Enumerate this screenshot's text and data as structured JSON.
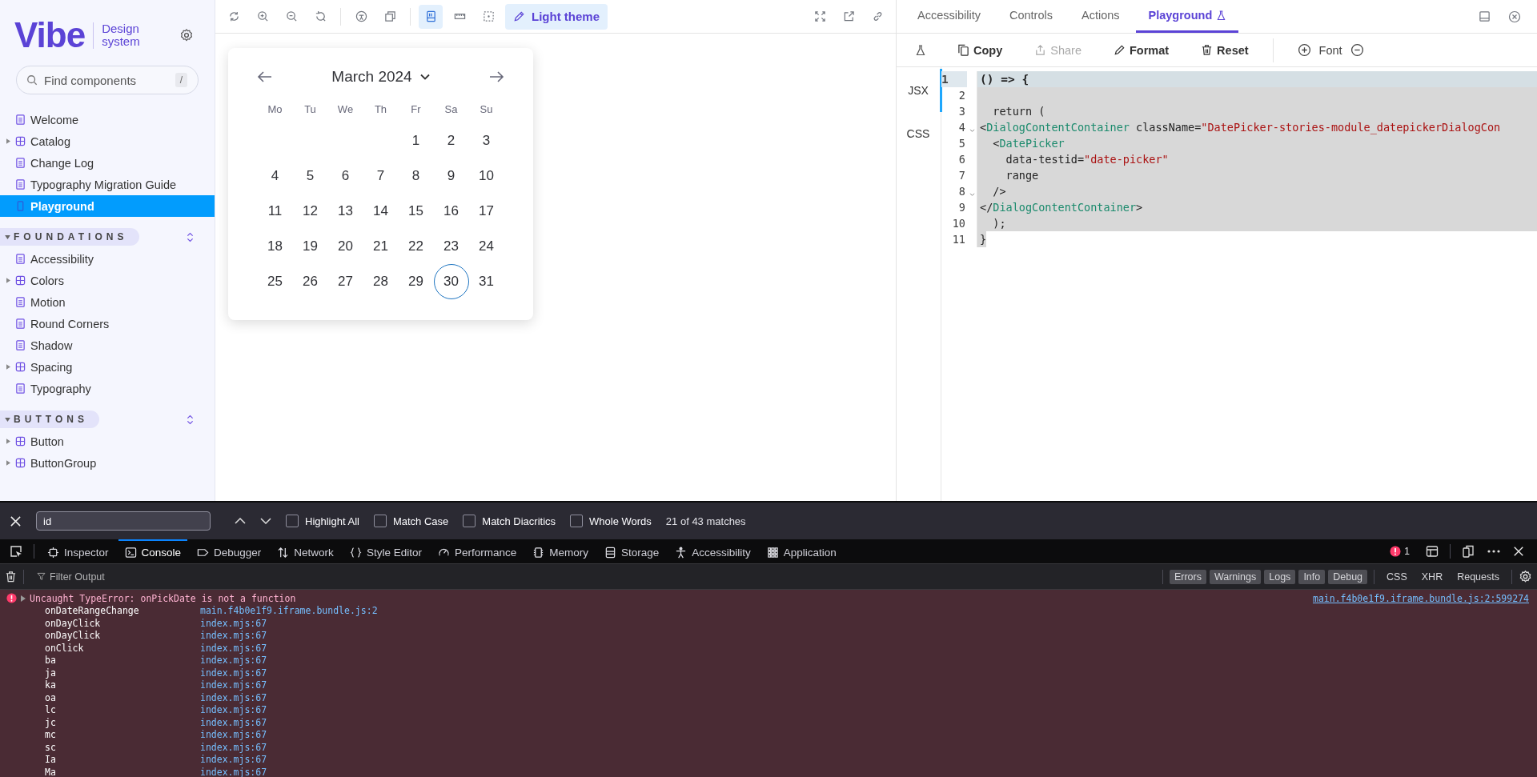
{
  "sidebar": {
    "logo": "Vibe",
    "logo_sub": "Design system",
    "search": {
      "placeholder": "Find components",
      "shortcut": "/"
    },
    "items": [
      {
        "label": "Welcome",
        "kind": "doc",
        "selected": false
      },
      {
        "label": "Catalog",
        "kind": "folder",
        "selected": false
      },
      {
        "label": "Change Log",
        "kind": "doc",
        "selected": false
      },
      {
        "label": "Typography Migration Guide",
        "kind": "doc",
        "selected": false
      },
      {
        "label": "Playground",
        "kind": "story",
        "selected": true
      }
    ],
    "sections": [
      {
        "title": "FOUNDATIONS",
        "expanded": true,
        "items": [
          {
            "label": "Accessibility",
            "kind": "doc",
            "selected": false
          },
          {
            "label": "Colors",
            "kind": "folder",
            "selected": false
          },
          {
            "label": "Motion",
            "kind": "doc",
            "selected": false
          },
          {
            "label": "Round Corners",
            "kind": "doc",
            "selected": false
          },
          {
            "label": "Shadow",
            "kind": "doc",
            "selected": false
          },
          {
            "label": "Spacing",
            "kind": "folder",
            "selected": false
          },
          {
            "label": "Typography",
            "kind": "doc",
            "selected": false
          }
        ]
      },
      {
        "title": "BUTTONS",
        "expanded": true,
        "items": [
          {
            "label": "Button",
            "kind": "folder",
            "selected": false
          },
          {
            "label": "ButtonGroup",
            "kind": "folder",
            "selected": false
          }
        ]
      }
    ]
  },
  "toolbar": {
    "groups": [
      {
        "tools": [
          {
            "kind": "refresh",
            "selected": false
          },
          {
            "kind": "zoom-in",
            "selected": false
          },
          {
            "kind": "zoom-out",
            "selected": false
          },
          {
            "kind": "reset",
            "selected": false
          }
        ]
      },
      {
        "tools": [
          {
            "kind": "accessibility",
            "selected": false
          },
          {
            "kind": "layers",
            "selected": false
          }
        ]
      },
      {
        "tools": [
          {
            "kind": "viewport",
            "selected": true
          },
          {
            "kind": "ruler",
            "selected": false
          },
          {
            "kind": "outline",
            "selected": false
          }
        ]
      }
    ],
    "theme": {
      "label": "Light theme",
      "selected": true
    },
    "right_tools": [
      {
        "kind": "fullscreen",
        "selected": false
      },
      {
        "kind": "external",
        "selected": false
      },
      {
        "kind": "link",
        "selected": false
      }
    ]
  },
  "calendar": {
    "title": "March 2024",
    "weekdays": [
      "Mo",
      "Tu",
      "We",
      "Th",
      "Fr",
      "Sa",
      "Su"
    ],
    "weeks": [
      {
        "days": [
          {
            "label": "1",
            "selected": false
          },
          {
            "label": "2",
            "selected": false
          },
          {
            "label": "3",
            "selected": false
          }
        ]
      },
      {
        "days": [
          {
            "label": "4",
            "selected": false
          },
          {
            "label": "5",
            "selected": false
          },
          {
            "label": "6",
            "selected": false
          },
          {
            "label": "7",
            "selected": false
          },
          {
            "label": "8",
            "selected": false
          },
          {
            "label": "9",
            "selected": false
          },
          {
            "label": "10",
            "selected": false
          }
        ]
      },
      {
        "days": [
          {
            "label": "11",
            "selected": false
          },
          {
            "label": "12",
            "selected": false
          },
          {
            "label": "13",
            "selected": false
          },
          {
            "label": "14",
            "selected": false
          },
          {
            "label": "15",
            "selected": false
          },
          {
            "label": "16",
            "selected": false
          },
          {
            "label": "17",
            "selected": false
          }
        ]
      },
      {
        "days": [
          {
            "label": "18",
            "selected": false
          },
          {
            "label": "19",
            "selected": false
          },
          {
            "label": "20",
            "selected": false
          },
          {
            "label": "21",
            "selected": false
          },
          {
            "label": "22",
            "selected": false
          },
          {
            "label": "23",
            "selected": false
          },
          {
            "label": "24",
            "selected": false
          }
        ]
      },
      {
        "days": [
          {
            "label": "25",
            "selected": false
          },
          {
            "label": "26",
            "selected": false
          },
          {
            "label": "27",
            "selected": false
          },
          {
            "label": "28",
            "selected": false
          },
          {
            "label": "29",
            "selected": false
          },
          {
            "label": "30",
            "selected": true
          },
          {
            "label": "31",
            "selected": false
          }
        ]
      }
    ]
  },
  "addon_panel": {
    "tabs": [
      {
        "label": "Accessibility",
        "selected": false
      },
      {
        "label": "Controls",
        "selected": false
      },
      {
        "label": "Actions",
        "selected": false
      },
      {
        "label": "Playground",
        "selected": true
      }
    ],
    "actions": [
      {
        "kind": "copy",
        "label": "Copy",
        "disabled": false
      },
      {
        "kind": "share",
        "label": "Share",
        "disabled": true
      },
      {
        "kind": "format",
        "label": "Format",
        "disabled": false
      },
      {
        "kind": "reset",
        "label": "Reset",
        "disabled": false
      }
    ],
    "font_label": "Font",
    "side_tabs": [
      {
        "label": "JSX",
        "selected": true
      },
      {
        "label": "CSS",
        "selected": false
      }
    ],
    "code_lines": [
      {
        "number": "1",
        "active": true,
        "foldable": false,
        "tokens": [
          {
            "kind": "plain",
            "text": "() => {"
          }
        ]
      },
      {
        "number": "2",
        "active": false,
        "foldable": false
      },
      {
        "number": "3",
        "active": false,
        "foldable": false,
        "tokens": [
          {
            "kind": "plain",
            "text": "  return ("
          }
        ]
      },
      {
        "number": "4",
        "active": false,
        "foldable": true,
        "tokens": [
          {
            "kind": "plain",
            "text": "<"
          },
          {
            "kind": "tag",
            "text": "DialogContentContainer"
          },
          {
            "kind": "plain",
            "text": " className="
          },
          {
            "kind": "string",
            "text": "\"DatePicker-stories-module_datepickerDialogCon"
          }
        ]
      },
      {
        "number": "5",
        "active": false,
        "foldable": false,
        "tokens": [
          {
            "kind": "plain",
            "text": "  <"
          },
          {
            "kind": "tag",
            "text": "DatePicker"
          }
        ]
      },
      {
        "number": "6",
        "active": false,
        "foldable": false,
        "tokens": [
          {
            "kind": "plain",
            "text": "    data-testid="
          },
          {
            "kind": "string",
            "text": "\"date-picker\""
          }
        ]
      },
      {
        "number": "7",
        "active": false,
        "foldable": false,
        "tokens": [
          {
            "kind": "plain",
            "text": "    range"
          }
        ]
      },
      {
        "number": "8",
        "active": false,
        "foldable": true,
        "tokens": [
          {
            "kind": "plain",
            "text": "  />"
          }
        ]
      },
      {
        "number": "9",
        "active": false,
        "foldable": false,
        "tokens": [
          {
            "kind": "plain",
            "text": "</"
          },
          {
            "kind": "tag",
            "text": "DialogContentContainer"
          },
          {
            "kind": "plain",
            "text": ">"
          }
        ]
      },
      {
        "number": "10",
        "active": false,
        "foldable": false,
        "tokens": [
          {
            "kind": "plain",
            "text": "  );"
          }
        ]
      },
      {
        "number": "11",
        "active": false,
        "foldable": false,
        "tokens": [
          {
            "kind": "plain",
            "text": "}"
          }
        ]
      }
    ]
  },
  "find_bar": {
    "value": "id",
    "options": [
      {
        "label": "Highlight All",
        "checked": false
      },
      {
        "label": "Match Case",
        "checked": false
      },
      {
        "label": "Match Diacritics",
        "checked": false
      },
      {
        "label": "Whole Words",
        "checked": false
      }
    ],
    "result": "21 of 43 matches"
  },
  "devtools": {
    "tabs": [
      {
        "kind": "inspector",
        "label": "Inspector",
        "selected": false
      },
      {
        "kind": "console",
        "label": "Console",
        "selected": true
      },
      {
        "kind": "debugger",
        "label": "Debugger",
        "selected": false
      },
      {
        "kind": "network",
        "label": "Network",
        "selected": false
      },
      {
        "kind": "style",
        "label": "Style Editor",
        "selected": false
      },
      {
        "kind": "performance",
        "label": "Performance",
        "selected": false
      },
      {
        "kind": "memory",
        "label": "Memory",
        "selected": false
      },
      {
        "kind": "storage",
        "label": "Storage",
        "selected": false
      },
      {
        "kind": "accessibility",
        "label": "Accessibility",
        "selected": false
      },
      {
        "kind": "application",
        "label": "Application",
        "selected": false
      }
    ],
    "error_count": "1",
    "filter": {
      "placeholder": "Filter Output",
      "levels": [
        {
          "label": "Errors",
          "selected": true
        },
        {
          "label": "Warnings",
          "selected": true
        },
        {
          "label": "Logs",
          "selected": true
        },
        {
          "label": "Info",
          "selected": true
        },
        {
          "label": "Debug",
          "selected": true
        }
      ],
      "types": [
        {
          "label": "CSS",
          "selected": false
        },
        {
          "label": "XHR",
          "selected": false
        },
        {
          "label": "Requests",
          "selected": false
        }
      ]
    },
    "error": {
      "message": "Uncaught TypeError: onPickDate is not a function",
      "location": "main.f4b0e1f9.iframe.bundle.js:2:599274",
      "frames": [
        {
          "function": "onDateRangeChange",
          "location": "main.f4b0e1f9.iframe.bundle.js:2"
        },
        {
          "function": "onDayClick",
          "location": "index.mjs:67"
        },
        {
          "function": "onDayClick",
          "location": "index.mjs:67"
        },
        {
          "function": "onClick",
          "location": "index.mjs:67"
        },
        {
          "function": "ba",
          "location": "index.mjs:67"
        },
        {
          "function": "ja",
          "location": "index.mjs:67"
        },
        {
          "function": "ka",
          "location": "index.mjs:67"
        },
        {
          "function": "oa",
          "location": "index.mjs:67"
        },
        {
          "function": "lc",
          "location": "index.mjs:67"
        },
        {
          "function": "jc",
          "location": "index.mjs:67"
        },
        {
          "function": "mc",
          "location": "index.mjs:67"
        },
        {
          "function": "sc",
          "location": "index.mjs:67"
        },
        {
          "function": "Ia",
          "location": "index.mjs:67"
        },
        {
          "function": "Ma",
          "location": "index.mjs:67"
        }
      ]
    }
  }
}
